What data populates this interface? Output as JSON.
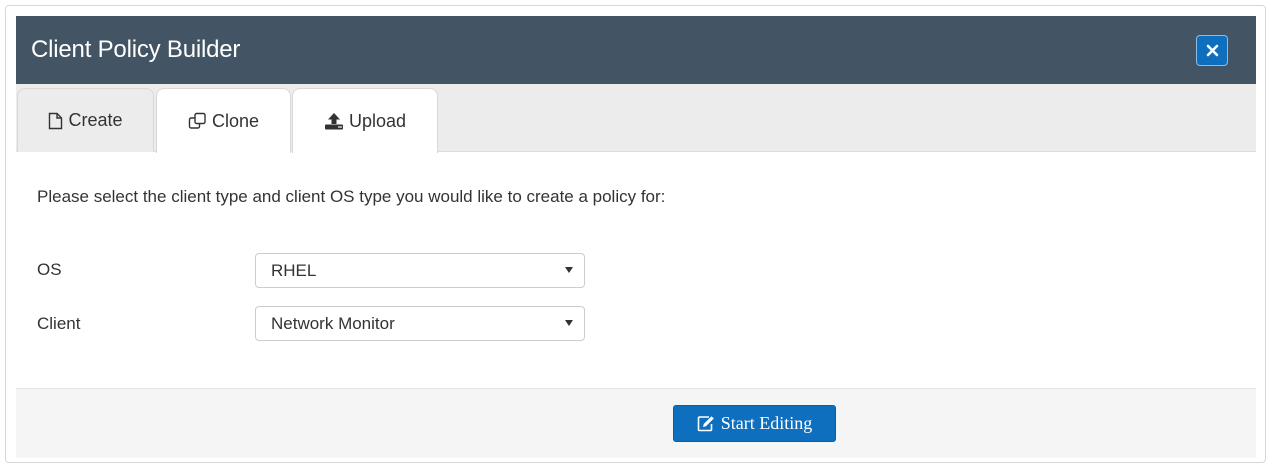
{
  "modal": {
    "title": "Client Policy Builder"
  },
  "tabs": [
    {
      "label": "Create",
      "icon": "file-icon",
      "active": false
    },
    {
      "label": "Clone",
      "icon": "clone-icon",
      "active": true
    },
    {
      "label": "Upload",
      "icon": "upload-icon",
      "active": true
    }
  ],
  "body": {
    "instructions": "Please select the client type and client OS type you would like to create a policy for:",
    "os": {
      "label": "OS",
      "selected": "RHEL"
    },
    "client": {
      "label": "Client",
      "selected": "Network Monitor"
    }
  },
  "footer": {
    "start_label": "Start Editing"
  },
  "colors": {
    "header_bg": "#435464",
    "primary": "#0f6fbf",
    "tabbar_bg": "#ececec",
    "footer_bg": "#f5f5f5"
  }
}
